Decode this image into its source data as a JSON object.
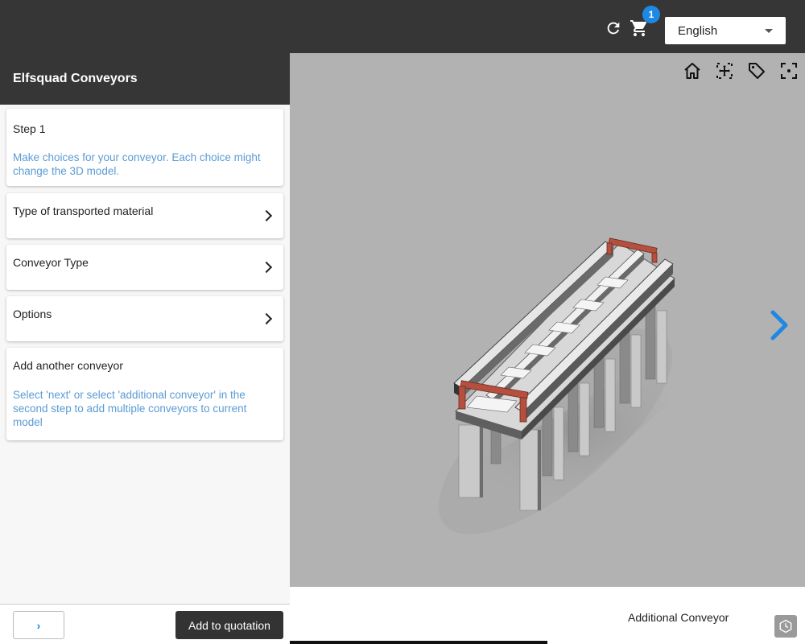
{
  "header": {
    "cart_count": "1",
    "language": "English"
  },
  "sidebar": {
    "title": "Elfsquad Conveyors",
    "cards": [
      {
        "title": "Step 1",
        "desc": "Make choices for your conveyor. Each choice might change the 3D model."
      },
      {
        "title": "Type of transported material"
      },
      {
        "title": "Conveyor Type"
      },
      {
        "title": "Options"
      },
      {
        "title": "Add another conveyor",
        "desc": "Select 'next' or select 'additional conveyor' in the second step to add multiple conveyors to current model"
      }
    ]
  },
  "footer": {
    "next_label": "›",
    "add_to_quotation": "Add to quotation"
  },
  "viewer": {
    "tools": [
      "home-icon",
      "focus-icon",
      "tag-icon",
      "fullscreen-icon"
    ],
    "next_step_label": "Additional Conveyor"
  },
  "colors": {
    "header_bg": "#363636",
    "accent": "#1e88e5",
    "desc_text": "#5a9bd5",
    "viewer_bg": "#b2b2b2"
  }
}
